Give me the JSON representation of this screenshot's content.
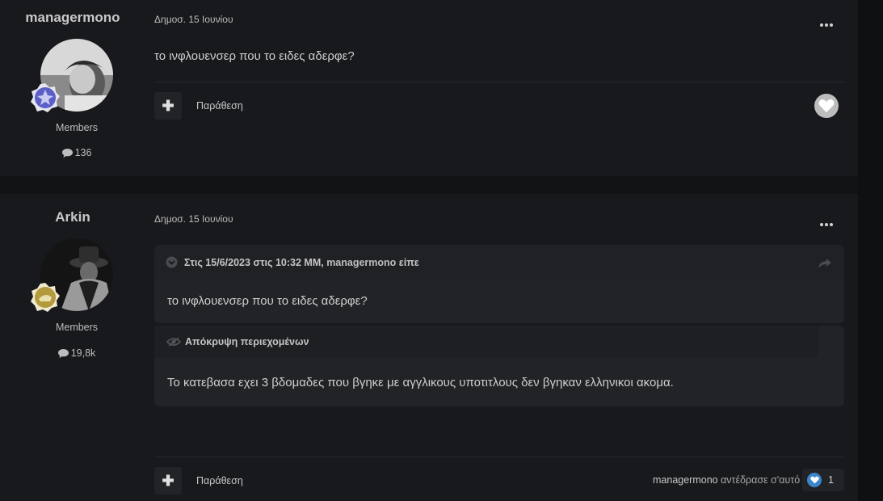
{
  "posts": [
    {
      "author": "managermono",
      "group": "Members",
      "post_count": "136",
      "date": "Δημοσ. 15 Ιουνίου",
      "content": "το ινφλουενσερ που το ειδες αδερφε?",
      "quote_label": "Παράθεση"
    },
    {
      "author": "Arkin",
      "group": "Members",
      "post_count": "19,8k",
      "date": "Δημοσ. 15 Ιουνίου",
      "quote": {
        "citation_prefix": "Στις 15/6/2023 στις 10:32 ΜΜ, ",
        "citation_author": "managermono",
        "citation_suffix": " είπε",
        "text": "το ινφλουενσερ που το ειδες αδερφε?"
      },
      "spoiler": {
        "title": "Απόκρυψη περιεχομένων",
        "text": "Το κατεβασα εχει 3 βδομαδες που βγηκε με αγγλικους υποτιτλους δεν βγηκαν ελληνικοι ακομα."
      },
      "quote_label": "Παράθεση",
      "reaction": {
        "user": "managermono",
        "text": " αντέδρασε σ'αυτό",
        "count": "1"
      }
    }
  ],
  "colors": {
    "background": "#121315",
    "post_bg": "#18191c",
    "reaction_blue": "#3a86c8"
  }
}
